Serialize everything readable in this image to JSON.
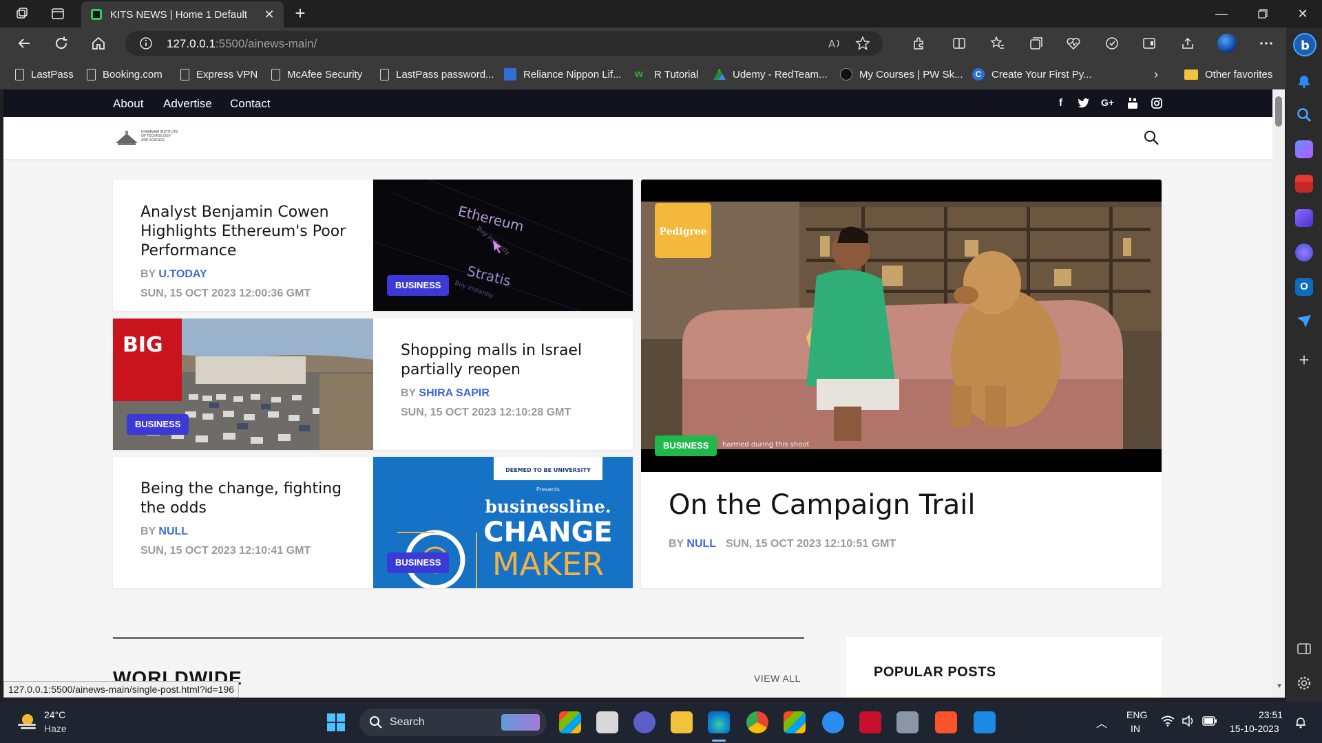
{
  "browser": {
    "tab_title": "KITS NEWS | Home 1 Default",
    "url_host": "127.0.0.1",
    "url_rest": ":5500/ainews-main/",
    "status_url": "127.0.0.1:5500/ainews-main/single-post.html?id=196"
  },
  "favorites": {
    "items": [
      "LastPass",
      "Booking.com",
      "Express VPN",
      "McAfee Security",
      "LastPass password...",
      "Reliance Nippon Lif...",
      "R Tutorial",
      "Udemy - RedTeam...",
      "My Courses | PW Sk...",
      "Create Your First Py..."
    ],
    "other": "Other favorites"
  },
  "site": {
    "nav": [
      "About",
      "Advertise",
      "Contact"
    ],
    "logo_lines": [
      "KHAMMAM INSTITUTE",
      "OF TECHNOLOGY",
      "AND SCIENCE"
    ]
  },
  "posts": [
    {
      "title": "Analyst Benjamin Cowen Highlights Ethereum's Poor Performance",
      "by": "BY",
      "author": "U.TODAY",
      "date": "SUN, 15 OCT 2023 12:00:36 GMT",
      "category": "BUSINESS"
    },
    {
      "title": "Shopping malls in Israel partially reopen",
      "by": "BY",
      "author": "SHIRA SAPIR",
      "date": "SUN, 15 OCT 2023 12:10:28 GMT",
      "category": "BUSINESS"
    },
    {
      "title": "Being the change, fighting the odds",
      "by": "BY",
      "author": "NULL",
      "date": "SUN, 15 OCT 2023 12:10:41 GMT",
      "category": "BUSINESS"
    }
  ],
  "featured": {
    "title": "On the Campaign Trail",
    "by": "BY",
    "author": "NULL",
    "date": "SUN, 15 OCT 2023 12:10:51 GMT",
    "category": "BUSINESS",
    "brand": "Pedigree",
    "caption": "harmed during this shoot"
  },
  "image_text": {
    "eth1": "Ethereum",
    "eth2": "Buy instantly",
    "eth3": "Stratis",
    "eth4": "Buy instantly",
    "mall": "BIG",
    "bl1": "DEEMED TO BE UNIVERSITY",
    "bl2": "Presents",
    "bl3": "businessline.",
    "bl4": "CHANGE",
    "bl5": "MAKER"
  },
  "sections": {
    "worldwide": "WORLDWIDE",
    "view_all": "VIEW ALL",
    "popular": "POPULAR POSTS"
  },
  "taskbar": {
    "temp": "24°C",
    "weather": "Haze",
    "search": "Search",
    "lang1": "ENG",
    "lang2": "IN",
    "time": "23:51",
    "date": "15-10-2023"
  },
  "colors": {
    "badge_blue": "#3b3ad6",
    "badge_green": "#1fb84a",
    "author_blue": "#3a69d8",
    "site_topbar": "#13131f"
  }
}
